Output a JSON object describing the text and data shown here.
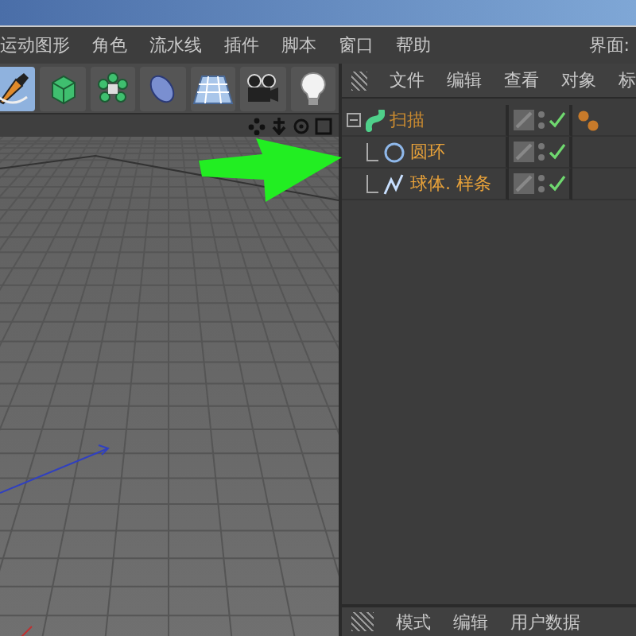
{
  "menu_bar": {
    "items": [
      "运动图形",
      "角色",
      "流水线",
      "插件",
      "脚本",
      "窗口",
      "帮助"
    ],
    "layout_label": "界面:"
  },
  "toolbar": {
    "tools": [
      {
        "kind": "pen",
        "selected": true
      },
      {
        "kind": "cube",
        "selected": false
      },
      {
        "kind": "cloner",
        "selected": false
      },
      {
        "kind": "deformer",
        "selected": false
      },
      {
        "kind": "floor",
        "selected": false
      },
      {
        "kind": "camera",
        "selected": false
      },
      {
        "kind": "light",
        "selected": false
      }
    ]
  },
  "object_manager": {
    "menu": [
      "文件",
      "编辑",
      "查看",
      "对象",
      "标"
    ],
    "objects": [
      {
        "name": "扫描",
        "kind": "sweep",
        "expanded": true,
        "visible": true,
        "has_tag": true,
        "children": [
          {
            "name": "圆环",
            "kind": "circle",
            "visible": true
          },
          {
            "name": "球体. 样条",
            "kind": "spline",
            "visible": true
          }
        ]
      }
    ]
  },
  "attribute_manager": {
    "menu": [
      "模式",
      "编辑",
      "用户数据"
    ]
  }
}
